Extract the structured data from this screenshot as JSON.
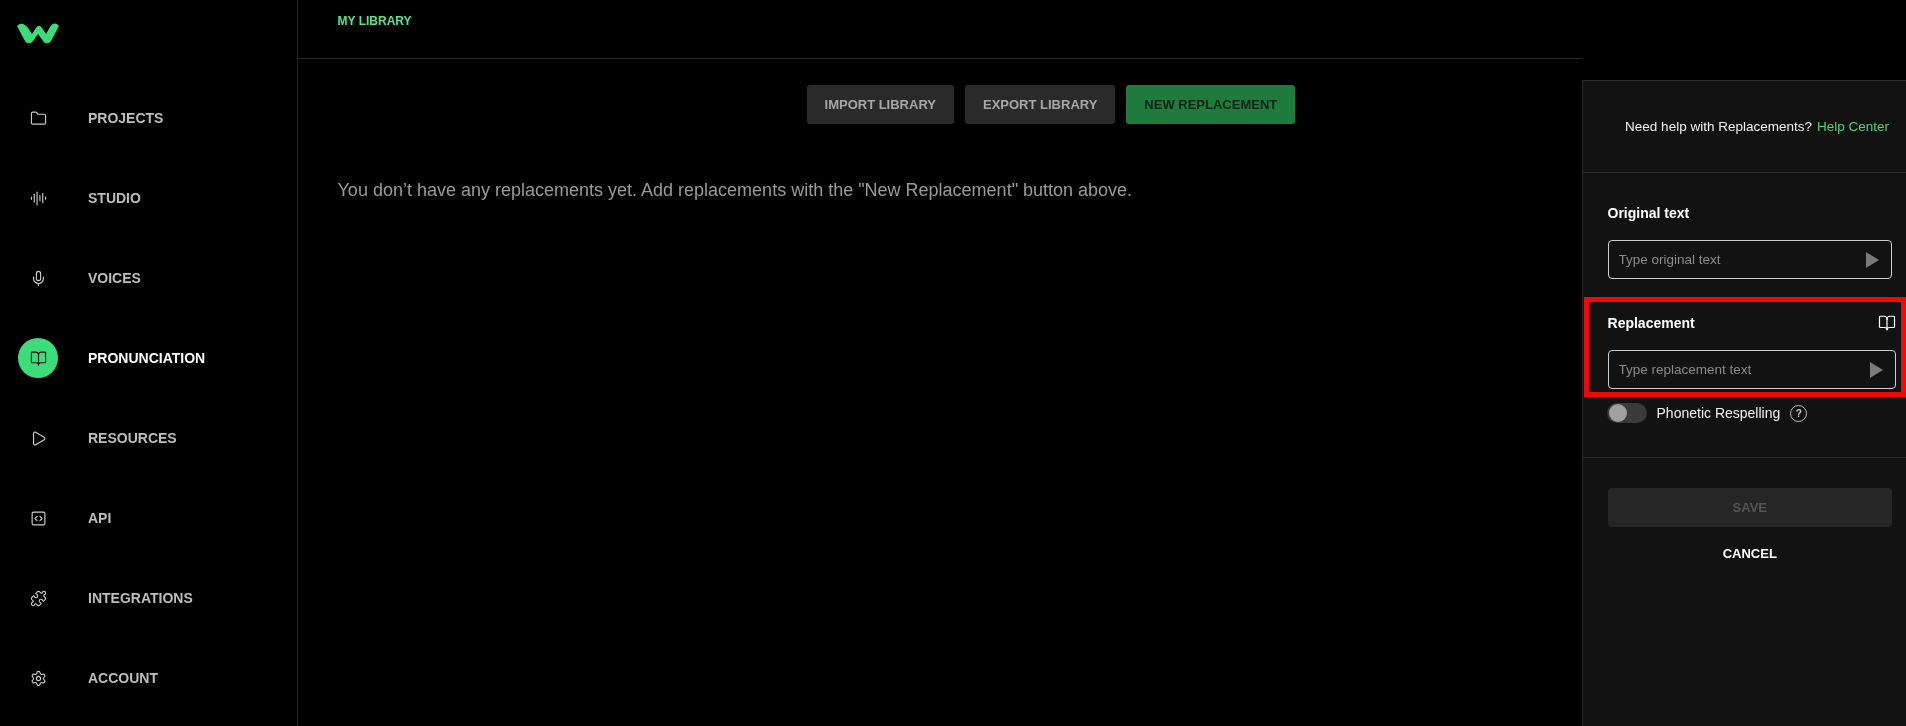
{
  "sidebar": {
    "items": [
      {
        "label": "PROJECTS",
        "selected": false
      },
      {
        "label": "STUDIO",
        "selected": false
      },
      {
        "label": "VOICES",
        "selected": false
      },
      {
        "label": "PRONUNCIATION",
        "selected": true
      },
      {
        "label": "RESOURCES",
        "selected": false
      },
      {
        "label": "API",
        "selected": false
      },
      {
        "label": "INTEGRATIONS",
        "selected": false
      },
      {
        "label": "ACCOUNT",
        "selected": false
      }
    ]
  },
  "breadcrumb": "MY LIBRARY",
  "toolbar": {
    "buttons": [
      {
        "label": "IMPORT LIBRARY",
        "kind": "secondary"
      },
      {
        "label": "EXPORT LIBRARY",
        "kind": "secondary"
      },
      {
        "label": "NEW REPLACEMENT",
        "kind": "primary"
      }
    ]
  },
  "empty_message": "You don’t have any replacements yet. Add replacements with the \"New Replacement\" button above.",
  "panel": {
    "help_text": "Need help with Replacements?",
    "help_link": "Help Center",
    "original": {
      "label": "Original text",
      "placeholder": "Type original text"
    },
    "replacement": {
      "label": "Replacement",
      "placeholder": "Type replacement text",
      "highlighted": true
    },
    "phonetic": {
      "label": "Phonetic Respelling",
      "on": false,
      "info": "?"
    },
    "save": {
      "label": "SAVE",
      "disabled": true
    },
    "cancel": "CANCEL"
  }
}
